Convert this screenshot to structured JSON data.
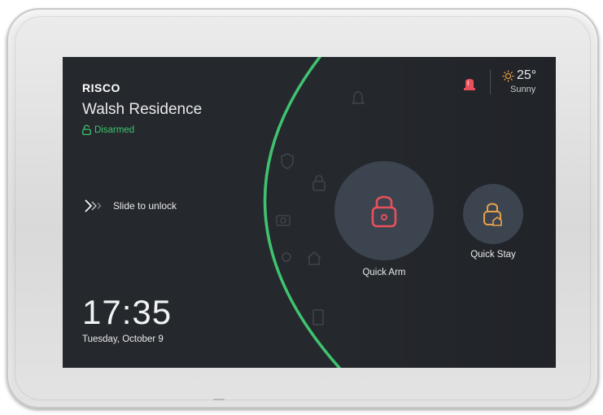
{
  "header": {
    "brand": "RISCO",
    "residence": "Walsh Residence",
    "status": "Disarmed"
  },
  "slide": {
    "label": "Slide to unlock"
  },
  "clock": {
    "time": "17:35",
    "date": "Tuesday, October 9"
  },
  "weather": {
    "temperature": "25°",
    "condition": "Sunny",
    "icon": "sun-icon"
  },
  "actions": {
    "quick_arm_label": "Quick Arm",
    "quick_stay_label": "Quick Stay"
  },
  "colors": {
    "screen_bg": "#25282d",
    "accent_green": "#3fc36f",
    "arm_red": "#e8505b",
    "stay_orange": "#e9a14a",
    "button_bg": "#3c4450"
  }
}
